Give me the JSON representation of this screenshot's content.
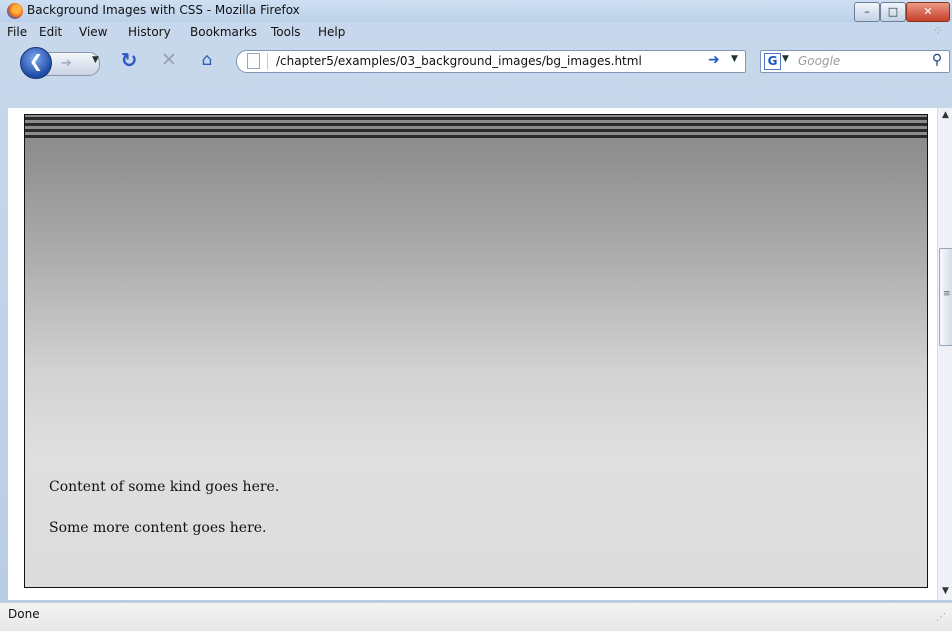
{
  "window": {
    "title": "Background Images with CSS - Mozilla Firefox",
    "controls": {
      "minimize": "–",
      "maximize": "□",
      "close": "✕"
    }
  },
  "menu": [
    {
      "label": "File"
    },
    {
      "label": "Edit"
    },
    {
      "label": "View"
    },
    {
      "label": "History"
    },
    {
      "label": "Bookmarks"
    },
    {
      "label": "Tools"
    },
    {
      "label": "Help"
    }
  ],
  "toolbar": {
    "back_icon": "back-arrow-icon",
    "forward_icon": "forward-arrow-icon",
    "reload_icon": "reload-icon",
    "stop_icon": "stop-icon",
    "home_icon": "home-icon",
    "url": "/chapter5/examples/03_background_images/bg_images.html",
    "go_icon": "go-arrow-icon",
    "search_engine_label": "G",
    "search_placeholder": "Google",
    "search_icon": "magnifier-icon"
  },
  "content": {
    "paragraphs": [
      "Content of some kind goes here.",
      "Some more content goes here."
    ]
  },
  "status": {
    "text": "Done"
  },
  "colors": {
    "header_stripes": "#2a2a2a",
    "gradient_top": "#8a8a8a",
    "gradient_bottom": "#dcdcdc",
    "link_blue": "#245bd1"
  }
}
